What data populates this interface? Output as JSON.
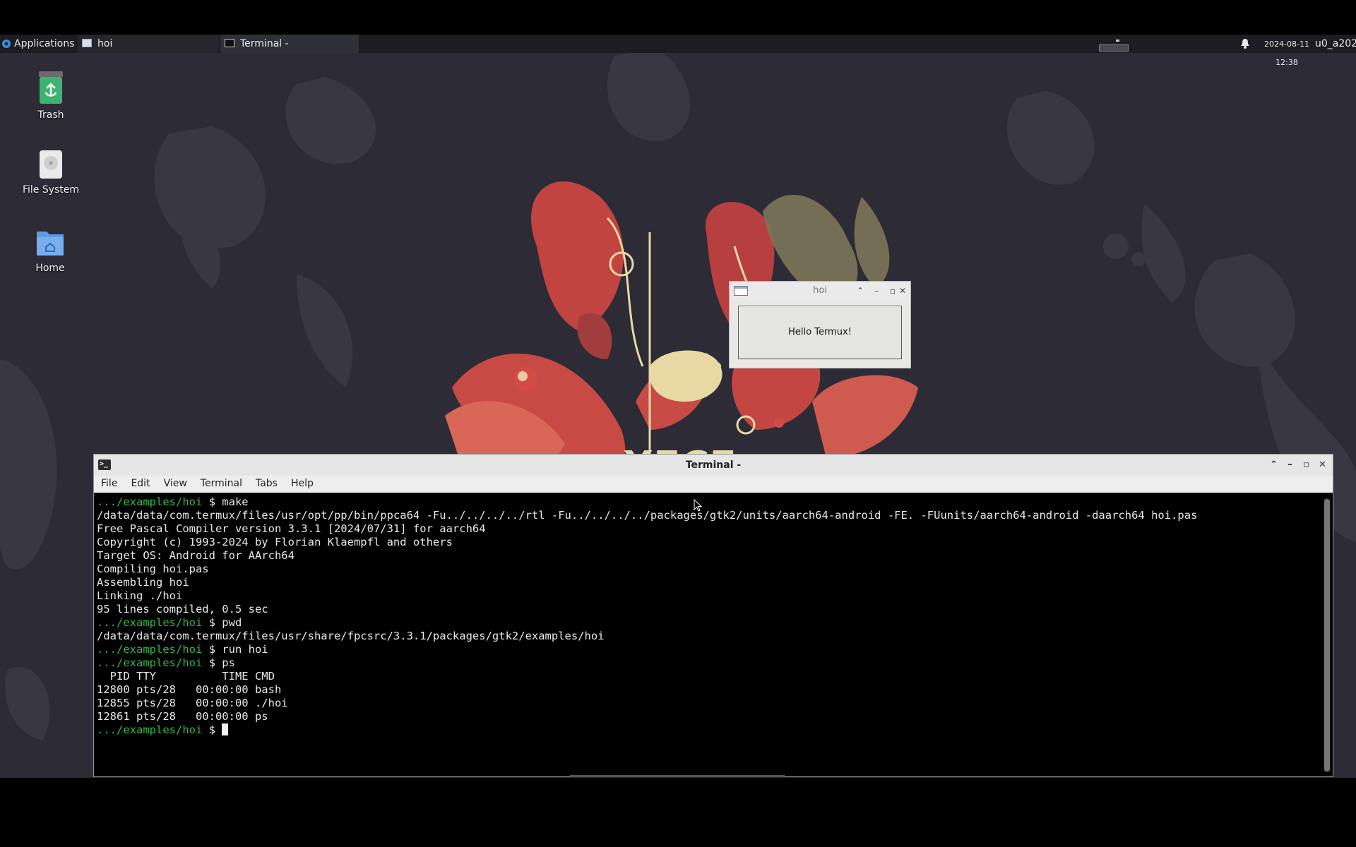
{
  "panel": {
    "applications_label": "Applications",
    "tasks": [
      {
        "label": "hoi",
        "icon": "window-icon"
      },
      {
        "label": "Terminal -",
        "icon": "terminal-icon"
      }
    ],
    "clock_date": "2024-08-11",
    "clock_time": "12:38",
    "user": "u0_a202"
  },
  "desktop": {
    "icons": [
      {
        "label": "Trash",
        "icon": "trash-icon"
      },
      {
        "label": "File System",
        "icon": "drive-icon"
      },
      {
        "label": "Home",
        "icon": "home-folder-icon"
      }
    ]
  },
  "hoi_window": {
    "title": "hoi",
    "button_label": "Hello Termux!"
  },
  "terminal": {
    "title": "Terminal -",
    "menu": [
      "File",
      "Edit",
      "View",
      "Terminal",
      "Tabs",
      "Help"
    ],
    "lines": [
      {
        "prompt": ".../examples/hoi",
        "text": " $ make"
      },
      {
        "prompt": "",
        "text": "/data/data/com.termux/files/usr/opt/pp/bin/ppca64 -Fu../../../../rtl -Fu../../../../packages/gtk2/units/aarch64-android -FE. -FUunits/aarch64-android -daarch64 hoi.pas"
      },
      {
        "prompt": "",
        "text": "Free Pascal Compiler version 3.3.1 [2024/07/31] for aarch64"
      },
      {
        "prompt": "",
        "text": "Copyright (c) 1993-2024 by Florian Klaempfl and others"
      },
      {
        "prompt": "",
        "text": "Target OS: Android for AArch64"
      },
      {
        "prompt": "",
        "text": "Compiling hoi.pas"
      },
      {
        "prompt": "",
        "text": "Assembling hoi"
      },
      {
        "prompt": "",
        "text": "Linking ./hoi"
      },
      {
        "prompt": "",
        "text": "95 lines compiled, 0.5 sec"
      },
      {
        "prompt": ".../examples/hoi",
        "text": " $ pwd"
      },
      {
        "prompt": "",
        "text": "/data/data/com.termux/files/usr/share/fpcsrc/3.3.1/packages/gtk2/examples/hoi"
      },
      {
        "prompt": ".../examples/hoi",
        "text": " $ run hoi"
      },
      {
        "prompt": ".../examples/hoi",
        "text": " $ ps"
      },
      {
        "prompt": "",
        "text": "  PID TTY          TIME CMD"
      },
      {
        "prompt": "",
        "text": "12800 pts/28   00:00:00 bash"
      },
      {
        "prompt": "",
        "text": "12855 pts/28   00:00:00 ./hoi"
      },
      {
        "prompt": "",
        "text": "12861 pts/28   00:00:00 ps"
      },
      {
        "prompt": ".../examples/hoi",
        "text": " $ ",
        "cursor": true
      }
    ]
  },
  "colors": {
    "desktop_bg": "#2d2b36",
    "panel_bg": "#1c1c22",
    "prompt": "#2fb84a"
  }
}
